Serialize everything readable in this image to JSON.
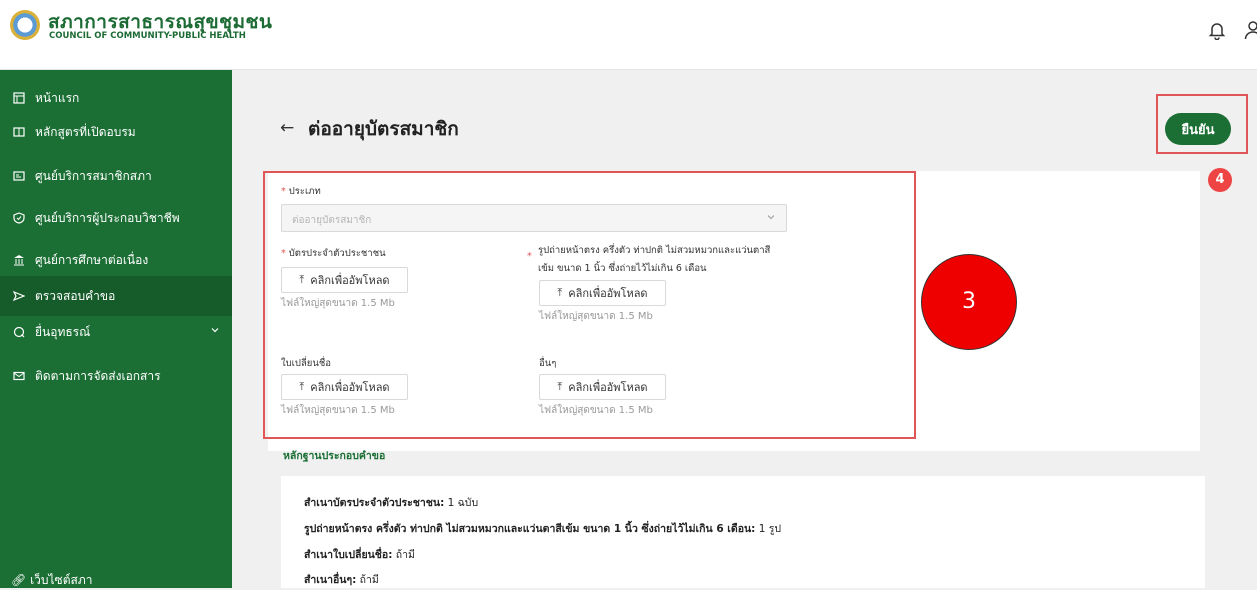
{
  "header": {
    "brand_th": "สภาการสาธารณสุขชุมชน",
    "brand_en": "COUNCIL OF COMMUNITY-PUBLIC HEALTH",
    "brand_color": "#1d6b34"
  },
  "sidebar": {
    "bg_color": "#1b6f35",
    "items": [
      {
        "label": "หน้าแรก",
        "icon": "home-icon"
      },
      {
        "label": "หลักสูตรที่เปิดอบรม",
        "icon": "book-icon"
      },
      {
        "label": "ศูนย์บริการสมาชิกสภา",
        "icon": "id-card-icon"
      },
      {
        "label": "ศูนย์บริการผู้ประกอบวิชาชีพ",
        "icon": "shield-icon"
      },
      {
        "label": "ศูนย์การศึกษาต่อเนื่อง",
        "icon": "bank-icon"
      },
      {
        "label": "ตรวจสอบคำขอ",
        "icon": "send-icon"
      },
      {
        "label": "ยื่นอุทธรณ์",
        "icon": "chat-icon"
      },
      {
        "label": "ติดตามการจัดส่งเอกสาร",
        "icon": "mail-icon"
      }
    ],
    "website": "เว็บไซต์สภา"
  },
  "page": {
    "back": "←",
    "title": "ต่ออายุบัตรสมาชิก",
    "confirm": "ยืนยัน",
    "marker_3": "3",
    "marker_4": "4"
  },
  "form": {
    "type_label": "ประเภท",
    "type_value": "ต่ออายุบัตรสมาชิก",
    "id_card_label": "บัตรประจำตัวประชาชน",
    "photo_label_1": "รูปถ่ายหน้าตรง ครึ่งตัว ท่าปกติ ไม่สวมหมวกและแว่นตาสี",
    "photo_label_2": "เข้ม ขนาด 1 นิ้ว ซึ่งถ่ายไว้ไม่เกิน 6 เดือน",
    "name_change_label": "ใบเปลี่ยนชื่อ",
    "other_label": "อื่นๆ",
    "upload_label": "คลิกเพื่ออัพโหลด",
    "max_size": "ไฟล์ใหญ่สุดขนาด 1.5 Mb"
  },
  "evidence": {
    "title": "หลักฐานประกอบคำขอ",
    "items": [
      {
        "k": "สำเนาบัตรประจำตัวประชาชน:",
        "v": "1 ฉบับ"
      },
      {
        "k": "รูปถ่ายหน้าตรง ครึ่งตัว ท่าปกติ ไม่สวมหมวกและแว่นตาสีเข้ม ขนาด 1 นิ้ว ซึ่งถ่ายไว้ไม่เกิน 6 เดือน:",
        "v": "1 รูป"
      },
      {
        "k": "สำเนาใบเปลี่ยนชื่อ:",
        "v": "ถ้ามี"
      },
      {
        "k": "สำเนาอื่นๆ:",
        "v": "ถ้ามี"
      }
    ]
  }
}
